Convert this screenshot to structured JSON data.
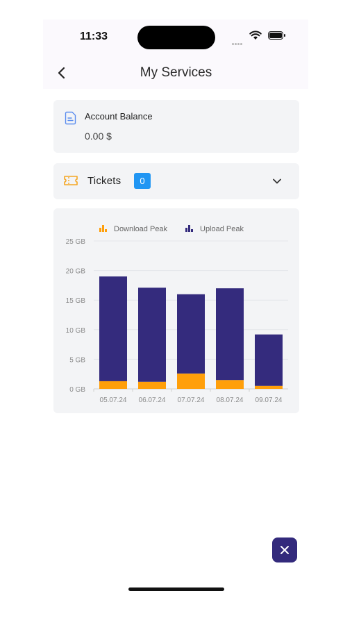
{
  "status_bar": {
    "time": "11:33"
  },
  "header": {
    "title": "My Services"
  },
  "balance": {
    "label": "Account Balance",
    "value": "0.00 $"
  },
  "tickets": {
    "label": "Tickets",
    "count": "0"
  },
  "colors": {
    "download": "#ff9f0a",
    "upload": "#342b7d",
    "badge": "#2196f3",
    "fab": "#332a7c"
  },
  "chart_data": {
    "type": "bar",
    "stacked": true,
    "categories": [
      "05.07.24",
      "06.07.24",
      "07.07.24",
      "08.07.24",
      "09.07.24"
    ],
    "series": [
      {
        "name": "Download Peak",
        "values": [
          1.3,
          1.2,
          2.6,
          1.5,
          0.5
        ]
      },
      {
        "name": "Upload Peak",
        "values": [
          17.7,
          15.9,
          13.4,
          15.5,
          8.7
        ]
      }
    ],
    "yticks": [
      "0 GB",
      "5 GB",
      "10 GB",
      "15 GB",
      "20 GB",
      "25 GB"
    ],
    "ylim": [
      0,
      25
    ],
    "legend": "top",
    "grid": true
  }
}
